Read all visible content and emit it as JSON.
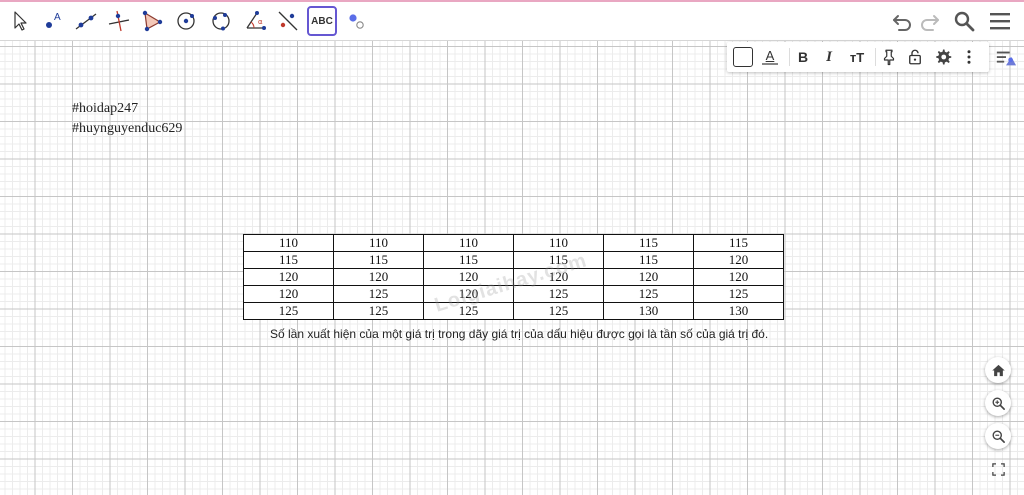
{
  "toolbar": {
    "tools": [
      {
        "name": "move-tool",
        "icon": "cursor-arrow-icon"
      },
      {
        "name": "point-tool",
        "icon": "point-a-icon"
      },
      {
        "name": "line-tool",
        "icon": "line-through-points-icon"
      },
      {
        "name": "perpendicular-line-tool",
        "icon": "perpendicular-icon"
      },
      {
        "name": "polygon-tool",
        "icon": "triangle-icon"
      },
      {
        "name": "circle-center-point-tool",
        "icon": "circle-center-icon"
      },
      {
        "name": "circle-three-points-tool",
        "icon": "circle-three-points-icon"
      },
      {
        "name": "angle-tool",
        "icon": "angle-icon"
      },
      {
        "name": "reflect-line-tool",
        "icon": "reflect-line-icon"
      },
      {
        "name": "text-tool",
        "icon": "text-abc-icon",
        "label": "ABC",
        "active": true
      },
      {
        "name": "slider-tool",
        "icon": "slider-points-icon"
      }
    ],
    "accent_color": "#6557d2"
  },
  "style_bar": {
    "bold_label": "B",
    "italic_label": "I",
    "text_color_label": "A",
    "font_size_label": "тT"
  },
  "canvas": {
    "notes": [
      "#hoidap247",
      "#huynguyenduc629"
    ],
    "table": {
      "rows": [
        [
          "110",
          "110",
          "110",
          "110",
          "115",
          "115"
        ],
        [
          "115",
          "115",
          "115",
          "115",
          "115",
          "120"
        ],
        [
          "120",
          "120",
          "120",
          "120",
          "120",
          "120"
        ],
        [
          "120",
          "125",
          "120",
          "125",
          "125",
          "125"
        ],
        [
          "125",
          "125",
          "125",
          "125",
          "130",
          "130"
        ]
      ]
    },
    "watermark": "Loigiaihay.com",
    "caption": "Số lần xuất hiện của một giá trị trong dãy giá trị của dấu hiệu được gọi là tần số của giá trị đó."
  }
}
